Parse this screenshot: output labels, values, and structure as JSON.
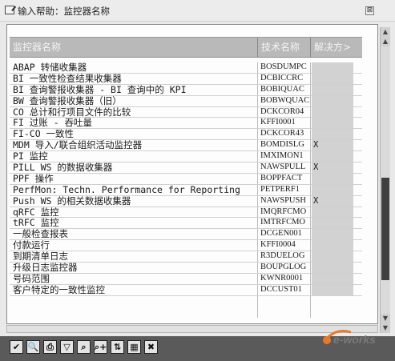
{
  "window": {
    "title": "输入帮助：监控器名称",
    "close_label": "⊠"
  },
  "table": {
    "headers": [
      "监控器名称",
      "技术名称",
      "解决方>"
    ],
    "rows": [
      {
        "name": "ABAP 转储收集器",
        "code": "BOSDUMPC",
        "sol": ""
      },
      {
        "name": "BI 一致性检查结果收集器",
        "code": "DCBICCRC",
        "sol": ""
      },
      {
        "name": "BI 查询警报收集器 - BI 查询中的 KPI",
        "code": "BOBIQUAC",
        "sol": ""
      },
      {
        "name": "BW 查询警报收集器（旧）",
        "code": "BOBWQUAC",
        "sol": ""
      },
      {
        "name": "CO 总计和行项目文件的比较",
        "code": "DCKCOR04",
        "sol": ""
      },
      {
        "name": "FI 过账 - 吞吐量",
        "code": "KFFI0001",
        "sol": ""
      },
      {
        "name": "FI-CO 一致性",
        "code": "DCKCOR43",
        "sol": ""
      },
      {
        "name": "MDM 导入/联合组织活动监控器",
        "code": "BOMDISLG",
        "sol": "X"
      },
      {
        "name": "PI 监控",
        "code": "IMXIMON1",
        "sol": ""
      },
      {
        "name": "PILL WS 的数据收集器",
        "code": "NAWSPULL",
        "sol": "X"
      },
      {
        "name": "PPF 操作",
        "code": "BOPPFACT",
        "sol": ""
      },
      {
        "name": "PerfMon: Techn. Performance for Reporting",
        "code": "PETPERF1",
        "sol": ""
      },
      {
        "name": "Push WS 的相关数据收集器",
        "code": "NAWSPUSH",
        "sol": "X"
      },
      {
        "name": "qRFC 监控",
        "code": "IMQRFCMO",
        "sol": ""
      },
      {
        "name": "tRFC 监控",
        "code": "IMTRFCMO",
        "sol": ""
      },
      {
        "name": "一般检查报表",
        "code": "DCGEN001",
        "sol": ""
      },
      {
        "name": "付款运行",
        "code": "KFFI0004",
        "sol": ""
      },
      {
        "name": "到期清单日志",
        "code": "R3DUELOG",
        "sol": ""
      },
      {
        "name": "升级日志监控器",
        "code": "BOUPGLOG",
        "sol": ""
      },
      {
        "name": "号码范围",
        "code": "KWNR0001",
        "sol": ""
      },
      {
        "name": "客户特定的一致性监控",
        "code": "DCCUST01",
        "sol": ""
      }
    ]
  },
  "toolbar": {
    "buttons": [
      {
        "icon": "check-icon",
        "glyph": "✔"
      },
      {
        "icon": "search-icon",
        "glyph": "🔍"
      },
      {
        "icon": "print-icon",
        "glyph": "⎙"
      },
      {
        "icon": "filter-icon",
        "glyph": "▽"
      },
      {
        "icon": "find-icon",
        "glyph": "⌕"
      },
      {
        "icon": "find-next-icon",
        "glyph": "⌕+"
      },
      {
        "icon": "sort-icon",
        "glyph": "⇅"
      },
      {
        "icon": "table-icon",
        "glyph": "▦"
      },
      {
        "icon": "cancel-icon",
        "glyph": "✖"
      }
    ]
  },
  "watermark": {
    "text": "e-works"
  },
  "colors": {
    "header_bg": "#b9b9b9",
    "solution_col_bg": "#d2d2d2",
    "toolbar_bg": "#5a5a5a",
    "logo_orange": "#e8782a"
  }
}
